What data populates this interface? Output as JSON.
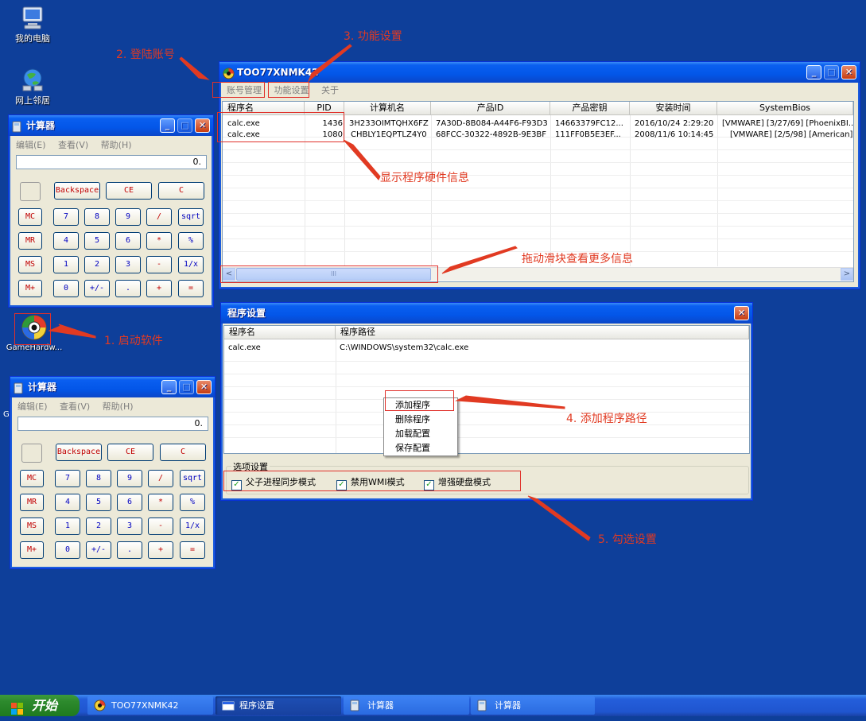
{
  "desktop": {
    "icons": [
      {
        "label": "我的电脑"
      },
      {
        "label": "网上邻居"
      },
      {
        "label": "GameHardw..."
      }
    ],
    "stray_char": "G"
  },
  "main_window": {
    "title": "TOO77XNMK42",
    "menu": [
      "账号管理",
      "功能设置",
      "关于"
    ],
    "columns": [
      "程序名",
      "PID",
      "计算机名",
      "产品ID",
      "产品密钥",
      "安装时间",
      "SystemBios"
    ],
    "rows": [
      [
        "calc.exe",
        "1436",
        "3H233OIMTQHX6FZ",
        "7A30D-8B084-A44F6-F93D3",
        "14663379FC12...",
        "2016/10/24 2:29:20",
        "[VMWARE] [3/27/69] [PhoenixBI..."
      ],
      [
        "calc.exe",
        "1080",
        "CHBLY1EQPTLZ4Y0",
        "68FCC-30322-4892B-9E3BF",
        "111FF0B5E3EF...",
        "2008/11/6 10:14:45",
        "[VMWARE] [2/5/98] [American]"
      ]
    ],
    "scroll_thumb_glyph": "III",
    "scroll_left": "<",
    "scroll_right": ">"
  },
  "calculator": {
    "title": "计算器",
    "menu": [
      "编辑(E)",
      "查看(V)",
      "帮助(H)"
    ],
    "display": "0.",
    "buttons": {
      "backspace": "Backspace",
      "ce": "CE",
      "c": "C",
      "mc": "MC",
      "mr": "MR",
      "ms": "MS",
      "mplus": "M+",
      "r1": [
        "7",
        "8",
        "9",
        "/",
        "sqrt"
      ],
      "r2": [
        "4",
        "5",
        "6",
        "*",
        "%"
      ],
      "r3": [
        "1",
        "2",
        "3",
        "-",
        "1/x"
      ],
      "r4": [
        "0",
        "+/-",
        ".",
        "+",
        "="
      ]
    }
  },
  "settings_window": {
    "title": "程序设置",
    "columns": [
      "程序名",
      "程序路径"
    ],
    "rows": [
      [
        "calc.exe",
        "C:\\WINDOWS\\system32\\calc.exe"
      ]
    ],
    "context_menu": [
      "添加程序",
      "删除程序",
      "加载配置",
      "保存配置"
    ],
    "group_title": "选项设置",
    "options": [
      {
        "label": "父子进程同步模式",
        "checked": true
      },
      {
        "label": "禁用WMI模式",
        "checked": true
      },
      {
        "label": "增强硬盘模式",
        "checked": true
      }
    ],
    "check_glyph": "✓"
  },
  "annotations": {
    "a1": "1. 启动软件",
    "a2": "2. 登陆账号",
    "a3": "3. 功能设置",
    "a4": "4. 添加程序路径",
    "a5": "5. 勾选设置",
    "info": "显示程序硬件信息",
    "drag": "拖动滑块查看更多信息",
    "color": "#e13a22"
  },
  "taskbar": {
    "start": "开始",
    "tasks": [
      "TOO77XNMK42",
      "程序设置",
      "计算器",
      "计算器"
    ]
  }
}
